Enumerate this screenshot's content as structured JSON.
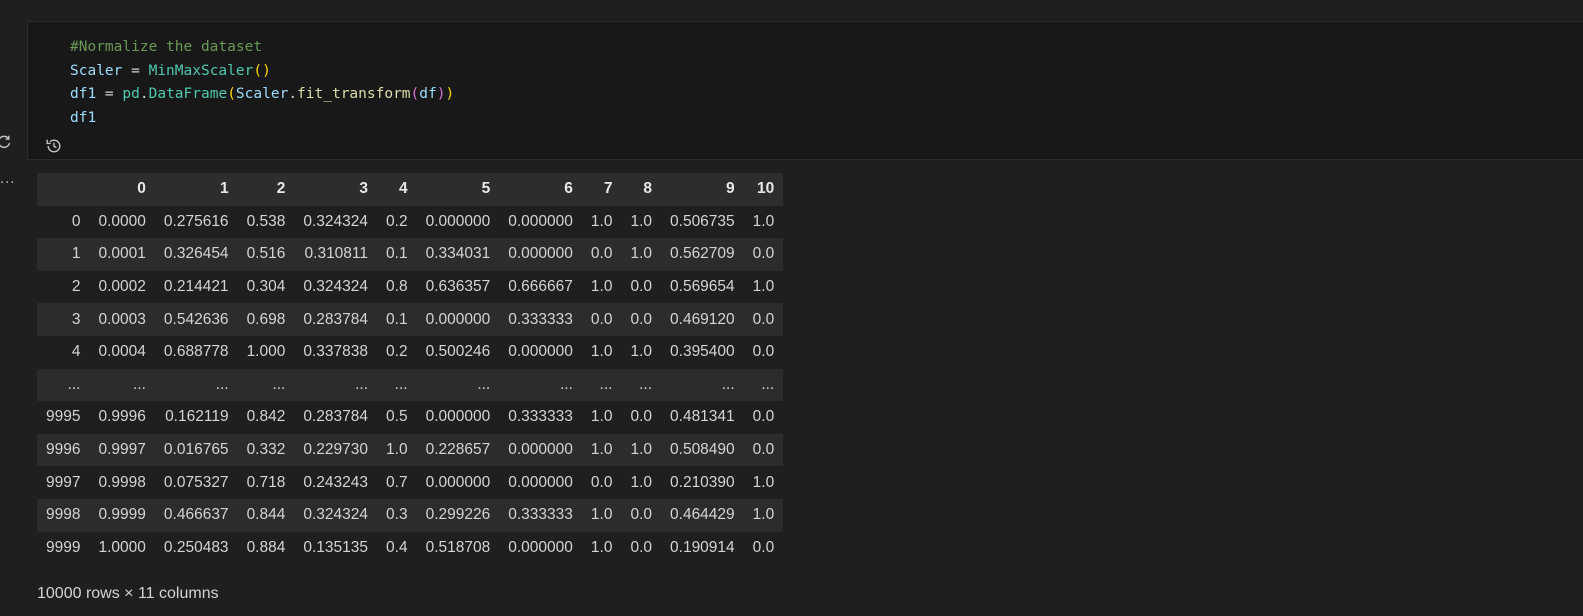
{
  "gutter": {
    "refresh_icon": "refresh-icon",
    "more_glyph": "..."
  },
  "cell": {
    "history_icon": "history-icon",
    "code": {
      "comment": "#Normalize the dataset",
      "line2": {
        "var": "Scaler",
        "eq": " = ",
        "cls": "MinMaxScaler",
        "open": "(",
        "close": ")"
      },
      "line3": {
        "var": "df1",
        "eq": " = ",
        "mod": "pd",
        "dot": ".",
        "cls": "DataFrame",
        "p1o": "(",
        "obj": "Scaler",
        "dot2": ".",
        "fn": "fit_transform",
        "p2o": "(",
        "arg": "df",
        "p2c": ")",
        "p1c": ")"
      },
      "line4": "df1"
    }
  },
  "output": {
    "columns": [
      "",
      "0",
      "1",
      "2",
      "3",
      "4",
      "5",
      "6",
      "7",
      "8",
      "9",
      "10"
    ],
    "rows": [
      [
        "0",
        "0.0000",
        "0.275616",
        "0.538",
        "0.324324",
        "0.2",
        "0.000000",
        "0.000000",
        "1.0",
        "1.0",
        "0.506735",
        "1.0"
      ],
      [
        "1",
        "0.0001",
        "0.326454",
        "0.516",
        "0.310811",
        "0.1",
        "0.334031",
        "0.000000",
        "0.0",
        "1.0",
        "0.562709",
        "0.0"
      ],
      [
        "2",
        "0.0002",
        "0.214421",
        "0.304",
        "0.324324",
        "0.8",
        "0.636357",
        "0.666667",
        "1.0",
        "0.0",
        "0.569654",
        "1.0"
      ],
      [
        "3",
        "0.0003",
        "0.542636",
        "0.698",
        "0.283784",
        "0.1",
        "0.000000",
        "0.333333",
        "0.0",
        "0.0",
        "0.469120",
        "0.0"
      ],
      [
        "4",
        "0.0004",
        "0.688778",
        "1.000",
        "0.337838",
        "0.2",
        "0.500246",
        "0.000000",
        "1.0",
        "1.0",
        "0.395400",
        "0.0"
      ],
      [
        "...",
        "...",
        "...",
        "...",
        "...",
        "...",
        "...",
        "...",
        "...",
        "...",
        "...",
        "..."
      ],
      [
        "9995",
        "0.9996",
        "0.162119",
        "0.842",
        "0.283784",
        "0.5",
        "0.000000",
        "0.333333",
        "1.0",
        "0.0",
        "0.481341",
        "0.0"
      ],
      [
        "9996",
        "0.9997",
        "0.016765",
        "0.332",
        "0.229730",
        "1.0",
        "0.228657",
        "0.000000",
        "1.0",
        "1.0",
        "0.508490",
        "0.0"
      ],
      [
        "9997",
        "0.9998",
        "0.075327",
        "0.718",
        "0.243243",
        "0.7",
        "0.000000",
        "0.000000",
        "0.0",
        "1.0",
        "0.210390",
        "1.0"
      ],
      [
        "9998",
        "0.9999",
        "0.466637",
        "0.844",
        "0.324324",
        "0.3",
        "0.299226",
        "0.333333",
        "1.0",
        "0.0",
        "0.464429",
        "1.0"
      ],
      [
        "9999",
        "1.0000",
        "0.250483",
        "0.884",
        "0.135135",
        "0.4",
        "0.518708",
        "0.000000",
        "1.0",
        "0.0",
        "0.190914",
        "0.0"
      ]
    ],
    "footer": "10000 rows × 11 columns"
  },
  "colors": {
    "background": "#1f1f1f",
    "cell_background": "#181818",
    "comment": "#6a9955",
    "variable": "#9cdcfe",
    "class": "#4ec9b0",
    "function": "#dcdcaa",
    "bracket_level1": "#ffd700",
    "bracket_level2": "#da70d6",
    "table_header_bg": "#2d2d2d",
    "table_stripe_bg": "#2c2c2c"
  }
}
